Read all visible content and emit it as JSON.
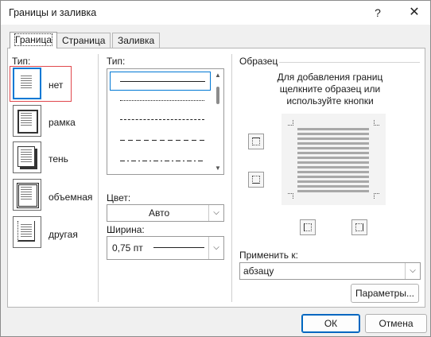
{
  "window": {
    "title": "Границы и заливка",
    "help": "?",
    "close": "✕"
  },
  "tabs": [
    {
      "label": "Граница"
    },
    {
      "label": "Страница"
    },
    {
      "label": "Заливка"
    }
  ],
  "setting": {
    "label": "Тип:",
    "items": [
      {
        "label": "нет",
        "icon": "setting-none-icon"
      },
      {
        "label": "рамка",
        "icon": "setting-box-icon"
      },
      {
        "label": "тень",
        "icon": "setting-shadow-icon"
      },
      {
        "label": "объемная",
        "icon": "setting-3d-icon"
      },
      {
        "label": "другая",
        "icon": "setting-custom-icon"
      }
    ]
  },
  "style": {
    "label": "Тип:",
    "items": [
      "solid",
      "dotted",
      "dashed-small",
      "dashed",
      "dash-dot"
    ]
  },
  "color": {
    "label": "Цвет:",
    "value": "Авто"
  },
  "width": {
    "label": "Ширина:",
    "value": "0,75 пт"
  },
  "preview": {
    "label": "Образец",
    "hint_lines": [
      "Для добавления границ",
      "щелкните образец или",
      "используйте кнопки"
    ]
  },
  "apply_to": {
    "label": "Применить к:",
    "value": "абзацу"
  },
  "buttons": {
    "options": "Параметры...",
    "ok": "ОК",
    "cancel": "Отмена"
  }
}
